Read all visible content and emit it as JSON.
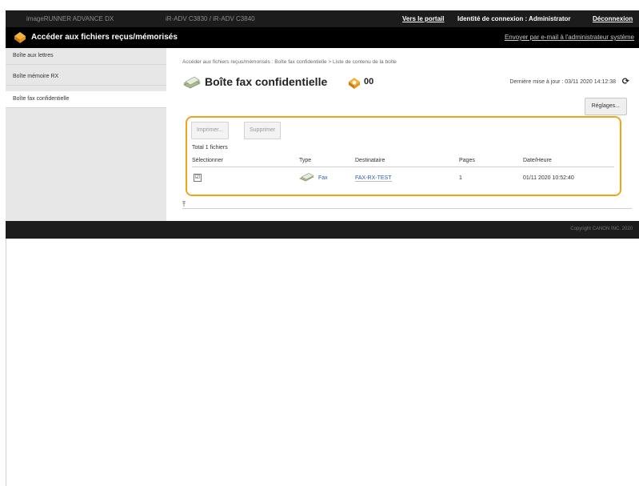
{
  "topbar": {
    "device_name": "imageRUNNER ADVANCE DX",
    "device_address": "iR-ADV C3830 / iR-ADV C3840",
    "portal_link": "Vers le portail",
    "login_identity": "Identité de connexion : Administrator",
    "logout": "Déconnexion"
  },
  "titlebar": {
    "title": "Accéder aux fichiers reçus/mémorisés",
    "send_mail": "Envoyer par e-mail à l'administrateur système"
  },
  "sidebar": {
    "items": [
      {
        "label": "Boîte aux lettres"
      },
      {
        "label": "Boîte mémoire RX"
      },
      {
        "label": "Boîte fax confidentielle"
      }
    ]
  },
  "main": {
    "breadcrumb": "Accéder aux fichiers reçus/mémorisés : Boîte fax confidentielle > Liste de contenu de la boîte",
    "title": "Boîte fax confidentielle",
    "box_number": "00",
    "last_updated": "Dernière mise à jour : 03/11 2020 14:12:38",
    "settings_button": "Réglages...",
    "print_button": "Imprimer...",
    "delete_button": "Supprimer",
    "total_files": "Total 1 fichiers",
    "table": {
      "headers": [
        "Sélectionner",
        "Type",
        "Destinataire",
        "Pages",
        "Date/Heure"
      ],
      "rows": [
        {
          "type": "Fax",
          "recipient": "FAX-RX-TEST",
          "pages": "1",
          "datetime": "01/11 2020 10:52:40",
          "checked": "☑"
        }
      ]
    }
  },
  "footer": {
    "copyright": "Copyright CANON INC. 2020"
  },
  "colors": {
    "accent": "#f2a31c",
    "link": "#2a5fb0",
    "header_bg": "#1c1c1c"
  }
}
